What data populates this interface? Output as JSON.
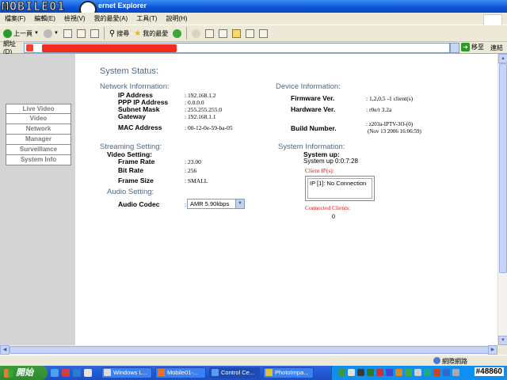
{
  "window": {
    "title": "ernet Explorer",
    "watermark": "MOBILE01"
  },
  "menu": {
    "items": [
      "檔案(F)",
      "編輯(E)",
      "檢視(V)",
      "我的最愛(A)",
      "工具(T)",
      "說明(H)"
    ]
  },
  "toolbar": {
    "back_label": "上一頁",
    "search_label": "搜尋",
    "favorites_label": "我的最愛"
  },
  "address": {
    "label": "網址(D)",
    "go_label": "移至",
    "links_label": "連結"
  },
  "nav": {
    "items": [
      "Live Video",
      "Video",
      "Network",
      "Manager",
      "Surveillance",
      "System Info"
    ]
  },
  "page": {
    "title": "System Status:",
    "network": {
      "heading": "Network Information:",
      "ip_label": "IP Address",
      "ip_value": ": 192.168.1.2",
      "ppp_label": "PPP IP Address",
      "ppp_value": ": 0.0.0.0",
      "mask_label": "Subnet Mask",
      "mask_value": ": 255.255.255.0",
      "gw_label": "Gateway",
      "gw_value": ": 192.168.1.1",
      "mac_label": "MAC Address",
      "mac_value": ": 00-12-0e-59-ba-05"
    },
    "device": {
      "heading": "Device Information:",
      "fw_label": "Firmware Ver.",
      "fw_value": ": 1,2,0,5 -1 client(s)",
      "hw_label": "Hardware Ver.",
      "hw_value": ": r0e/t 3.2a",
      "build_label": "Build Number.",
      "build_value_1": ": z203a-IPTV-3O-(0)",
      "build_value_2": "(Nov 13 2006 16:06:59)"
    },
    "streaming": {
      "heading": "Streaming Setting:",
      "video_heading": "Video Setting:",
      "framerate_label": "Frame Rate",
      "framerate_value": ": 23.00",
      "bitrate_label": "Bit Rate",
      "bitrate_value": ": 256",
      "framesize_label": "Frame Size",
      "framesize_value": ": SMALL",
      "audio_heading": "Audio Setting:",
      "codec_label": "Audio Codec",
      "codec_colon": ":",
      "codec_value": "AMR 5.90kbps"
    },
    "system": {
      "heading": "System Information:",
      "up_label": "System up:",
      "up_value": "System up 0:0:7:28",
      "clientip_label": "Client IP(s):",
      "clientip_value": "IP [1]: No Connection",
      "connected_label": "Connected Clients:",
      "connected_value": "0"
    }
  },
  "statusbar": {
    "zone": "網際網路"
  },
  "taskbar": {
    "start_label": "開始",
    "tasks": [
      "Windows L...",
      "Mobile01-...",
      "Control Ce...",
      "PhotoImpa..."
    ],
    "clock": "#48860"
  },
  "colors": {
    "heading": "#4d6b8a",
    "nav_bg": "#d4d4d4",
    "red_label": "#cc2222",
    "taskbar": "#245edb"
  }
}
